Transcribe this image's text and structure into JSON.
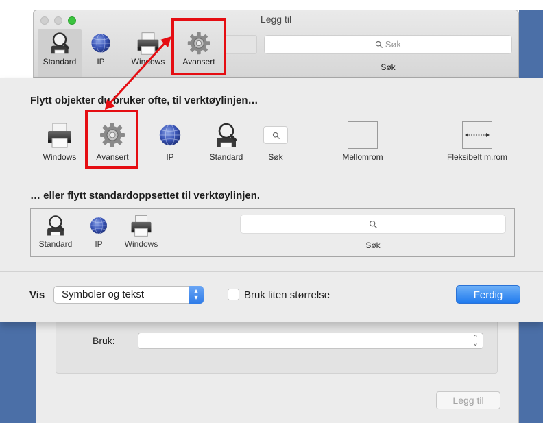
{
  "window": {
    "title": "Legg til"
  },
  "colors": {
    "accent": "#2f7ce8",
    "highlight": "#e50d12",
    "desktop": "#4b6fa7",
    "close": "#cfcfcf",
    "zoom": "#3bc43f"
  },
  "toolbar": {
    "items": [
      {
        "label": "Standard",
        "icon": "magnifier-icon"
      },
      {
        "label": "IP",
        "icon": "globe-icon"
      },
      {
        "label": "Windows",
        "icon": "printer-icon"
      },
      {
        "label": "Avansert",
        "icon": "gear-icon"
      }
    ],
    "search_placeholder": "Søk",
    "search_label": "Søk"
  },
  "palette": {
    "heading": "Flytt objekter du bruker ofte, til verktøylinjen…",
    "items": [
      {
        "label": "Windows",
        "icon": "printer-icon"
      },
      {
        "label": "Avansert",
        "icon": "gear-icon"
      },
      {
        "label": "IP",
        "icon": "globe-icon"
      },
      {
        "label": "Standard",
        "icon": "magnifier-icon"
      },
      {
        "label": "Søk",
        "icon": "search-icon"
      },
      {
        "label": "Mellomrom",
        "icon": "space-placeholder"
      },
      {
        "label": "Fleksibelt m.rom",
        "icon": "flexible-space-icon"
      }
    ]
  },
  "default_set": {
    "heading": "… eller flytt standardoppsettet til verktøylinjen.",
    "items": [
      {
        "label": "Standard",
        "icon": "magnifier-icon"
      },
      {
        "label": "IP",
        "icon": "globe-icon"
      },
      {
        "label": "Windows",
        "icon": "printer-icon"
      }
    ],
    "search_label": "Søk"
  },
  "footer": {
    "show_label": "Vis",
    "show_value": "Symboler og tekst",
    "small_size_label": "Bruk liten størrelse",
    "done_label": "Ferdig"
  },
  "background_form": {
    "use_label": "Bruk:",
    "add_button": "Legg til"
  }
}
